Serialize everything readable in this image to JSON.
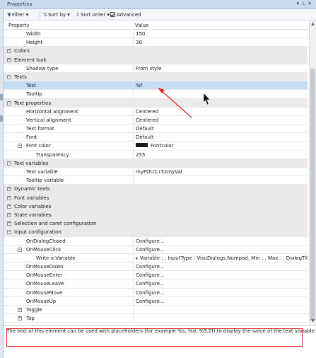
{
  "window": {
    "title": "Properties"
  },
  "toolbar": {
    "filter_label": "Filter",
    "sort_by_label": "Sort by",
    "sort_order_label": "Sort order",
    "advanced_label": "Advanced",
    "advanced_checked": true
  },
  "grid": {
    "header": {
      "property": "Property",
      "value": "Value"
    },
    "rows": [
      {
        "kind": "item",
        "indent": 1,
        "label": "Width",
        "value": "150"
      },
      {
        "kind": "item",
        "indent": 1,
        "label": "Height",
        "value": "30"
      },
      {
        "kind": "category",
        "expand": "+",
        "label": "Colors",
        "value": ""
      },
      {
        "kind": "category",
        "expand": "+",
        "label": "Element look",
        "value": ""
      },
      {
        "kind": "item",
        "indent": 1,
        "label": "Shadow type",
        "value": "From style"
      },
      {
        "kind": "category",
        "expand": "−",
        "label": "Texts",
        "value": ""
      },
      {
        "kind": "item",
        "indent": 1,
        "label": "Text",
        "value": "%f",
        "selected": true
      },
      {
        "kind": "item",
        "indent": 1,
        "label": "Tooltip",
        "value": ""
      },
      {
        "kind": "category",
        "expand": "−",
        "label": "Text properties",
        "value": ""
      },
      {
        "kind": "item",
        "indent": 1,
        "label": "Horizontal alignment",
        "value": "Centered"
      },
      {
        "kind": "item",
        "indent": 1,
        "label": "Vertical alignment",
        "value": "Centered"
      },
      {
        "kind": "item",
        "indent": 1,
        "label": "Text format",
        "value": "Default"
      },
      {
        "kind": "item",
        "indent": 1,
        "label": "Font",
        "value": "Default"
      },
      {
        "kind": "item",
        "indent": 1,
        "expand": "−",
        "label": "Font color",
        "value": "Fontcolor",
        "swatch": "#1a1a1a"
      },
      {
        "kind": "item",
        "indent": 2,
        "label": "Transparency",
        "value": "255"
      },
      {
        "kind": "category",
        "expand": "−",
        "label": "Text variables",
        "value": ""
      },
      {
        "kind": "item",
        "indent": 1,
        "label": "Text variable",
        "value": "myPOU2.r32myVal"
      },
      {
        "kind": "item",
        "indent": 1,
        "label": "Tooltip variable",
        "value": ""
      },
      {
        "kind": "category",
        "expand": "+",
        "label": "Dynamic texts",
        "value": ""
      },
      {
        "kind": "category",
        "expand": "+",
        "label": "Font variables",
        "value": ""
      },
      {
        "kind": "category",
        "expand": "+",
        "label": "Color variables",
        "value": ""
      },
      {
        "kind": "category",
        "expand": "+",
        "label": "State variables",
        "value": ""
      },
      {
        "kind": "category",
        "expand": "+",
        "label": "Selection and caret configuration",
        "value": ""
      },
      {
        "kind": "category",
        "expand": "−",
        "label": "Input configuration",
        "value": ""
      },
      {
        "kind": "item",
        "indent": 1,
        "label": "OnDialogClosed",
        "value": "Configure..."
      },
      {
        "kind": "item",
        "indent": 1,
        "expand": "−",
        "label": "OnMouseClick",
        "value": "Configure..."
      },
      {
        "kind": "item",
        "indent": 2,
        "label": "Write a Variable",
        "value": "Variable : , InputType : VisuDialogs.Numpad, Min : , Max : , DialogTitl...",
        "value_icon": true
      },
      {
        "kind": "item",
        "indent": 1,
        "label": "OnMouseDown",
        "value": "Configure..."
      },
      {
        "kind": "item",
        "indent": 1,
        "label": "OnMouseEnter",
        "value": "Configure..."
      },
      {
        "kind": "item",
        "indent": 1,
        "label": "OnMouseLeave",
        "value": "Configure..."
      },
      {
        "kind": "item",
        "indent": 1,
        "label": "OnMouseMove",
        "value": "Configure..."
      },
      {
        "kind": "item",
        "indent": 1,
        "label": "OnMouseUp",
        "value": "Configure..."
      },
      {
        "kind": "item",
        "indent": 1,
        "expand": "+",
        "label": "Toggle",
        "value": ""
      },
      {
        "kind": "item",
        "indent": 1,
        "expand": "+",
        "label": "Tap",
        "value": ""
      }
    ]
  },
  "description": {
    "text": "The text of this element can be used with placeholders (for example %s, %d, %5.2f) to display the value of the text variable."
  },
  "colors": {
    "selected_row": "#c4dcf4",
    "category_row": "#eaeaea",
    "annotation_red": "#e02a2a",
    "titlebar": "#c9d9ee"
  }
}
